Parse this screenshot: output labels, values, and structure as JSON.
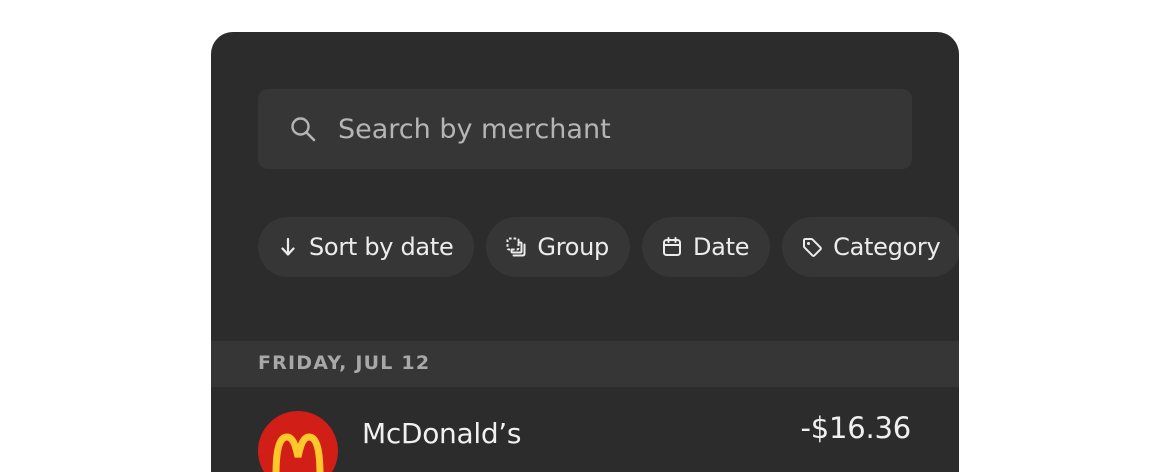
{
  "search": {
    "placeholder": "Search by merchant",
    "value": "",
    "icon": "search-icon"
  },
  "filters": [
    {
      "label": "Sort by date",
      "icon": "arrow-down-icon"
    },
    {
      "label": "Group",
      "icon": "group-icon"
    },
    {
      "label": "Date",
      "icon": "calendar-icon"
    },
    {
      "label": "Category",
      "icon": "tag-icon"
    }
  ],
  "transactions": {
    "date_header": "FRIDAY, JUL 12",
    "items": [
      {
        "merchant": "McDonald’s",
        "amount": "-$16.36",
        "logo": "mcdonalds-logo"
      }
    ]
  },
  "colors": {
    "panel_bg": "#2c2c2c",
    "control_bg": "#363636",
    "text": "#ececec",
    "muted_text": "#a8a8a8",
    "logo_red": "#d11f17",
    "logo_yellow": "#ffc72c"
  }
}
